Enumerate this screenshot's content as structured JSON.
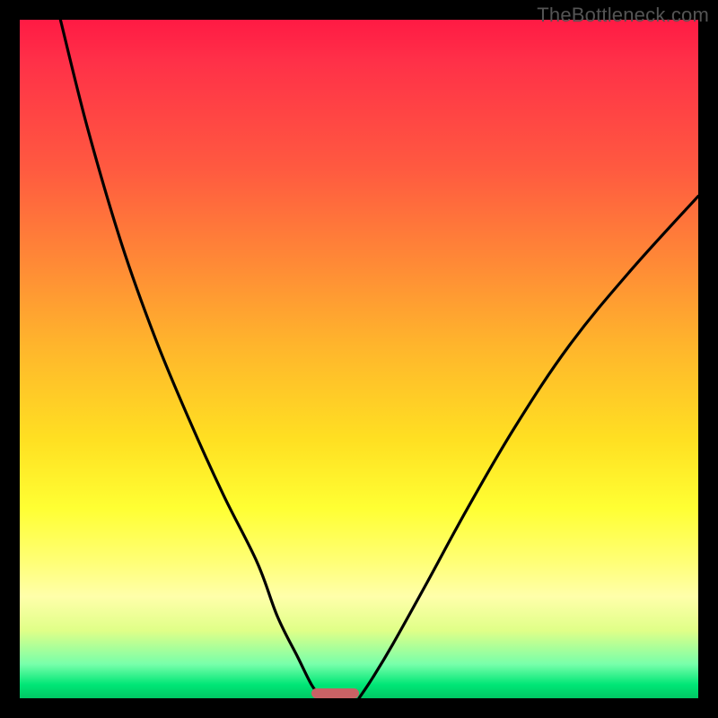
{
  "watermark": "TheBottleneck.com",
  "chart_data": {
    "type": "line",
    "title": "",
    "xlabel": "",
    "ylabel": "",
    "xlim": [
      0,
      100
    ],
    "ylim": [
      0,
      100
    ],
    "series": [
      {
        "name": "left-curve",
        "x": [
          6,
          10,
          15,
          20,
          25,
          30,
          35,
          38,
          41,
          43,
          44.5
        ],
        "values": [
          100,
          84,
          67,
          53,
          41,
          30,
          20,
          12,
          6,
          2,
          0
        ]
      },
      {
        "name": "right-curve",
        "x": [
          50,
          52,
          55,
          60,
          66,
          73,
          81,
          90,
          100
        ],
        "values": [
          0,
          3,
          8,
          17,
          28,
          40,
          52,
          63,
          74
        ]
      }
    ],
    "marker": {
      "x_start": 43,
      "x_end": 50,
      "color": "#c96265"
    },
    "gradient_colors": {
      "top": "#ff1a44",
      "mid_upper": "#ff8a36",
      "mid": "#ffe022",
      "mid_lower": "#ffff77",
      "bottom": "#00c864"
    }
  }
}
